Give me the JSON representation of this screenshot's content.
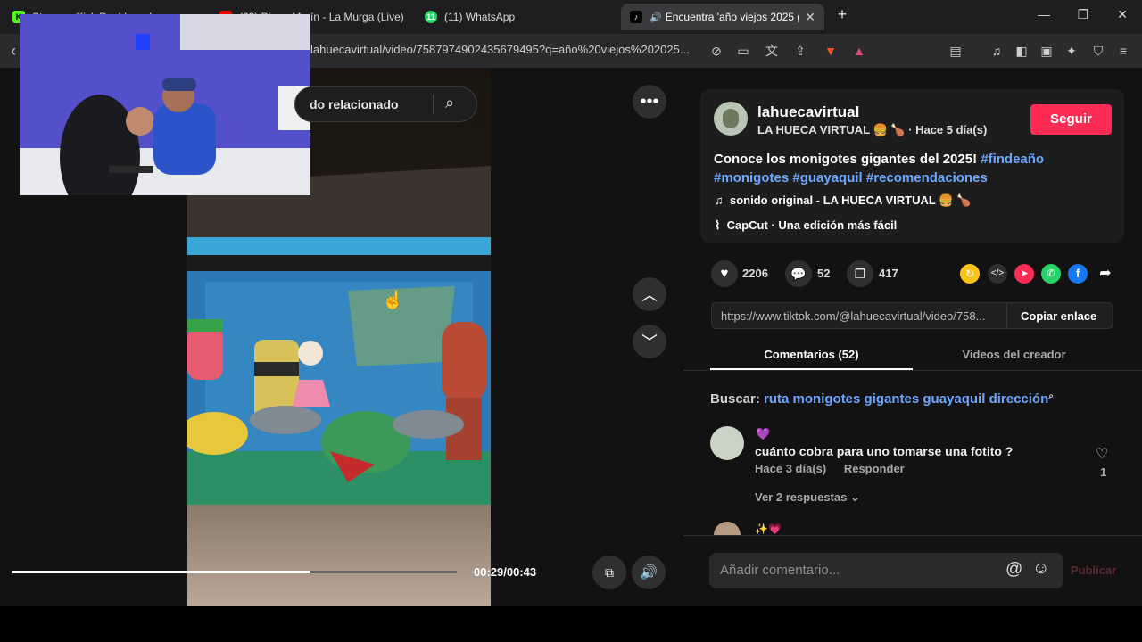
{
  "tabs": [
    {
      "label": "Stream - Kick Dashboard",
      "fav": "K",
      "fav_color": "#53fc18"
    },
    {
      "label": "(23) Diego Marín - La Murga (Live)",
      "fav": "",
      "fav_color": "#ff0000"
    },
    {
      "label": "(11) WhatsApp",
      "fav": "11",
      "fav_color": "#25d366"
    },
    {
      "label": "Encuentra 'año viejos 2025 gu",
      "fav": "♪",
      "fav_color": "#000000"
    }
  ],
  "new_tab": "+",
  "window": {
    "minimize": "—",
    "maximize": "❐",
    "close": "✕"
  },
  "address": {
    "url": "lahuecavirtual/video/7587974902435679495?q=año%20viejos%202025...",
    "brave_badge": "5",
    "alert_badge": "1"
  },
  "search": {
    "text": "do relacionado"
  },
  "video": {
    "time": "00:29/00:43",
    "progress": 0.67
  },
  "author": {
    "username": "lahuecavirtual",
    "display": "LA HUECA VIRTUAL 🍔 🍗",
    "ago": "· Hace 5 día(s)",
    "follow": "Seguir"
  },
  "caption": {
    "text": "Conoce los monigotes gigantes del 2025! ",
    "tags": [
      "#findeaño",
      "#monigotes",
      "#guayaquil",
      "#recomendaciones"
    ]
  },
  "music": "sonido original - LA HUECA VIRTUAL 🍔 🍗",
  "capcut": "CapCut · Una edición más fácil",
  "stats": {
    "likes": "2206",
    "comments": "52",
    "saves": "417"
  },
  "share": {
    "link": "https://www.tiktok.com/@lahuecavirtual/video/758...",
    "copy": "Copiar enlace"
  },
  "panel_tabs": {
    "comments": "Comentarios (52)",
    "creator": "Videos del creador"
  },
  "related_search": {
    "label": "Buscar:",
    "query": "ruta monigotes gigantes guayaquil dirección"
  },
  "comments": [
    {
      "emoji": "💜",
      "text": "cuánto cobra para uno tomarse una fotito ?",
      "ago": "Hace 3 día(s)",
      "reply": "Responder",
      "likes": "1",
      "more": "Ver 2 respuestas"
    },
    {
      "emoji": "✨💗"
    }
  ],
  "comment_input": {
    "placeholder": "Añadir comentario...",
    "at": "@",
    "publish": "Publicar"
  },
  "colors": {
    "accent": "#fe2c55",
    "hashtag": "#6aa7ff",
    "bg": "#121212"
  }
}
